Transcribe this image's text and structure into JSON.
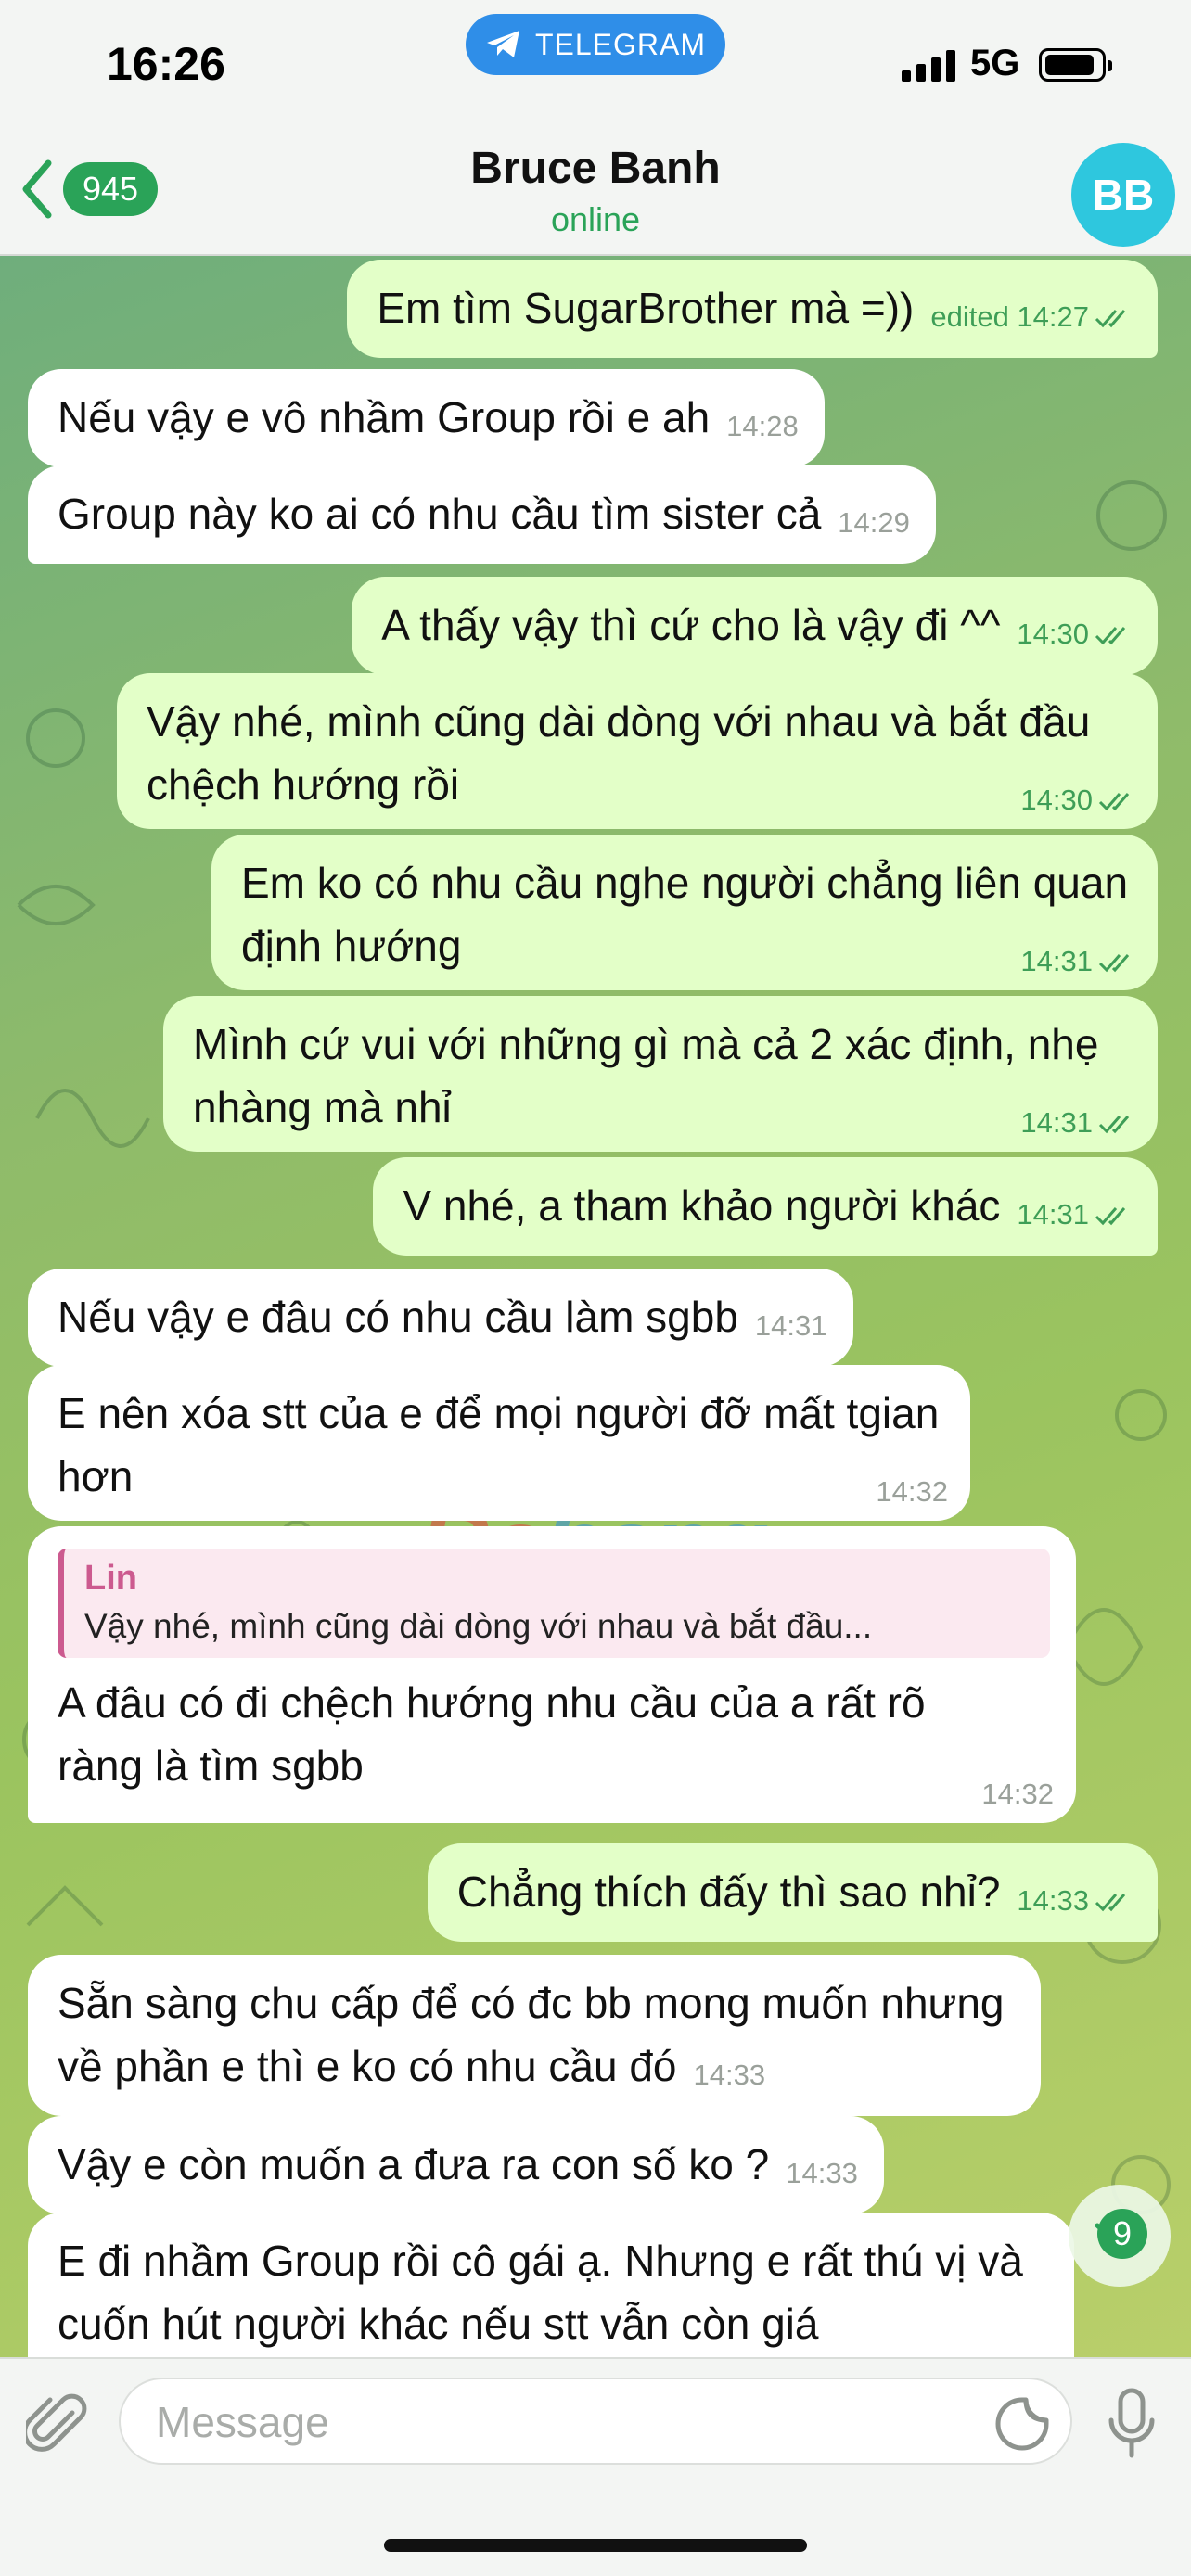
{
  "status_bar": {
    "time": "16:26",
    "app_pill": "TELEGRAM",
    "network": "5G"
  },
  "header": {
    "back_count": "945",
    "title": "Bruce Banh",
    "status": "online",
    "avatar_initials": "BB"
  },
  "messages": [
    {
      "dir": "out",
      "text": "Em tìm SugarBrother mà =))",
      "time": "edited 14:27"
    },
    {
      "dir": "in",
      "text": "Nếu vậy e vô nhầm Group rồi e ah",
      "time": "14:28"
    },
    {
      "dir": "in",
      "text": "Group này ko ai có nhu cầu tìm sister cả",
      "time": "14:29"
    },
    {
      "dir": "out",
      "text": "A thấy vậy thì cứ cho là vậy đi ^^",
      "time": "14:30"
    },
    {
      "dir": "out",
      "text": "Vậy nhé, mình cũng dài dòng với nhau và bắt đầu chệch hướng rồi",
      "time": "14:30"
    },
    {
      "dir": "out",
      "text": "Em ko có nhu cầu nghe người chẳng liên quan định hướng",
      "time": "14:31"
    },
    {
      "dir": "out",
      "text": "Mình cứ vui với những gì mà cả 2 xác định, nhẹ nhàng mà nhỉ",
      "time": "14:31"
    },
    {
      "dir": "out",
      "text": "V nhé, a tham khảo người khác",
      "time": "14:31"
    },
    {
      "dir": "in",
      "text": "Nếu vậy e đâu có nhu cầu làm sgbb",
      "time": "14:31"
    },
    {
      "dir": "in",
      "text": "E nên xóa stt của e để mọi người đỡ mất tgian hơn",
      "time": "14:32"
    },
    {
      "dir": "in",
      "reply_name": "Lin",
      "reply_text": "Vậy nhé, mình cũng dài dòng với nhau và bắt đầu...",
      "text": "A đâu có đi chệch hướng nhu cầu của a rất rõ ràng là tìm sgbb",
      "time": "14:32"
    },
    {
      "dir": "out",
      "text": "Chẳng thích đấy thì sao nhỉ?",
      "time": "14:33"
    },
    {
      "dir": "in",
      "text": "Sẵn sàng chu cấp để có đc bb mong muốn nhưng về phần e thì e ko có nhu cầu đó",
      "time": "14:33"
    },
    {
      "dir": "in",
      "text": "Vậy e còn muốn a đưa ra con số ko ?",
      "time": "14:33"
    },
    {
      "dir": "in",
      "text": "E đi nhầm Group rồi cô gái ạ. Nhưng e rất thú vị và cuốn hút người khác nếu stt vẫn còn giá",
      "time": ""
    }
  ],
  "watermark": {
    "part1": "Ro",
    "part2": "hang"
  },
  "scroll_badge": "9",
  "composer": {
    "placeholder": "Message"
  },
  "colors": {
    "accent": "#2aa358",
    "outgoing_bubble": "#e3ffc8",
    "incoming_bubble": "#ffffff",
    "reply_accent": "#cc5a8f",
    "pill": "#2f8ee8"
  }
}
